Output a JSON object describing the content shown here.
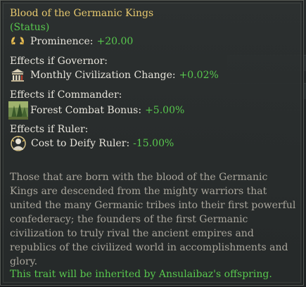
{
  "tooltip": {
    "title": "Blood of the Germanic Kings",
    "subtitle": "(Status)",
    "prominence": {
      "label": "Prominence:",
      "value": "+20.00",
      "icon": "laurel-wreath-icon"
    },
    "governor": {
      "header": "Effects if Governor:",
      "label": "Monthly Civilization Change:",
      "value": "+0.02%",
      "icon": "civic-building-icon"
    },
    "commander": {
      "header": "Effects if Commander:",
      "label": "Forest Combat Bonus:",
      "value": "+5.00%",
      "icon": "forest-icon"
    },
    "ruler": {
      "header": "Effects if Ruler:",
      "label": "Cost to Deify Ruler:",
      "value": "-15.00%",
      "icon": "deify-bust-icon"
    },
    "description": "Those that are born with the blood of the Germanic Kings are descended from the mighty warriors that united the many Germanic tribes into their first powerful confederacy; the founders of the first Germanic civilization to truly rival the ancient empires and republics of the civilized world in accomplishments and glory.",
    "inherit_note": "This trait will be inherited by Ansulaibaz's offspring.",
    "colors": {
      "title": "#e7c96f",
      "positive": "#58c84e",
      "text": "#e6e3da",
      "description": "#a9a59b"
    }
  }
}
